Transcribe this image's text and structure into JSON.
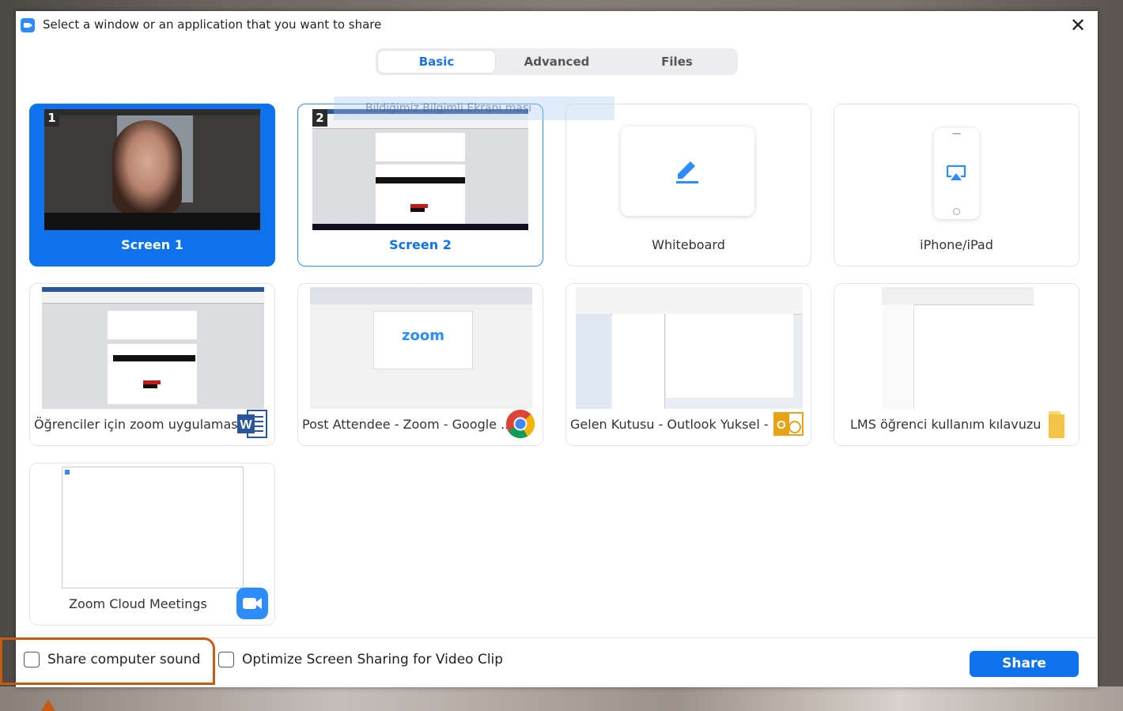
{
  "dialog": {
    "title": "Select a window or an application that you want to share",
    "close_glyph": "✕"
  },
  "tabs": [
    {
      "label": "Basic",
      "active": true
    },
    {
      "label": "Advanced",
      "active": false
    },
    {
      "label": "Files",
      "active": false
    }
  ],
  "tiles": [
    {
      "label": "Screen 1",
      "badge": "1",
      "selected": true
    },
    {
      "label": "Screen 2",
      "badge": "2",
      "selected": false
    },
    {
      "label": "Whiteboard",
      "icon": "pen-icon"
    },
    {
      "label": "iPhone/iPad",
      "icon": "airplay-icon"
    },
    {
      "label": "Öğrenciler için zoom uygulaması...",
      "icon": "word-icon"
    },
    {
      "label": "Post Attendee - Zoom - Google ...",
      "icon": "chrome-icon",
      "thumb_logo": "zoom"
    },
    {
      "label": "Gelen Kutusu - Outlook Yuksel - ...",
      "icon": "outlook-icon"
    },
    {
      "label": "LMS öğrenci kullanım kılavuzu",
      "icon": "folder-icon"
    },
    {
      "label": "Zoom Cloud Meetings",
      "icon": "zoom-icon"
    }
  ],
  "ghost_text": "Bildiğimiz Bilgimli Ekranı ması",
  "footer": {
    "share_sound_label": "Share computer sound",
    "optimize_label": "Optimize Screen Sharing for Video Clip",
    "share_button": "Share"
  },
  "colors": {
    "accent": "#0e72ed",
    "highlight": "#c55a11"
  }
}
